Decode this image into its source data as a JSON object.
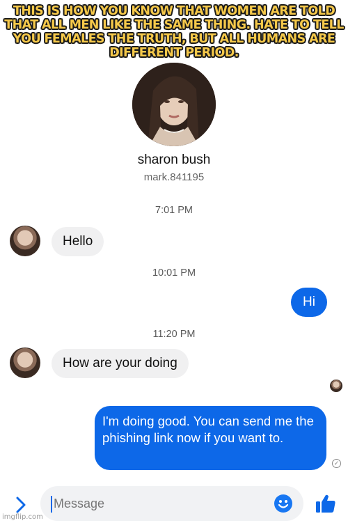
{
  "meme": {
    "caption": "THIS IS HOW YOU KNOW THAT WOMEN ARE TOLD THAT ALL MEN LIKE THE SAME THING. HATE TO TELL YOU FEMALES THE TRUTH, BUT ALL HUMANS ARE DIFFERENT PERIOD."
  },
  "profile": {
    "name": "sharon bush",
    "handle": "mark.841195"
  },
  "conversation": {
    "timestamps": [
      "7:01 PM",
      "10:01 PM",
      "11:20 PM"
    ],
    "messages": [
      {
        "direction": "incoming",
        "text": "Hello"
      },
      {
        "direction": "outgoing",
        "text": "Hi"
      },
      {
        "direction": "incoming",
        "text": "How are your doing"
      },
      {
        "direction": "outgoing",
        "text": "I'm doing good. You can send me the phishing link now if you want to."
      }
    ]
  },
  "composer": {
    "placeholder": "Message",
    "icons": [
      "chevron-right-icon",
      "emoji-icon",
      "thumbs-up-icon"
    ]
  },
  "colors": {
    "accent": "#0d68e8",
    "incoming_bubble": "#f0f0f1",
    "caption_fill": "#f6c94a",
    "emoji_face": "#1877f2"
  },
  "watermark": "imgflip.com"
}
